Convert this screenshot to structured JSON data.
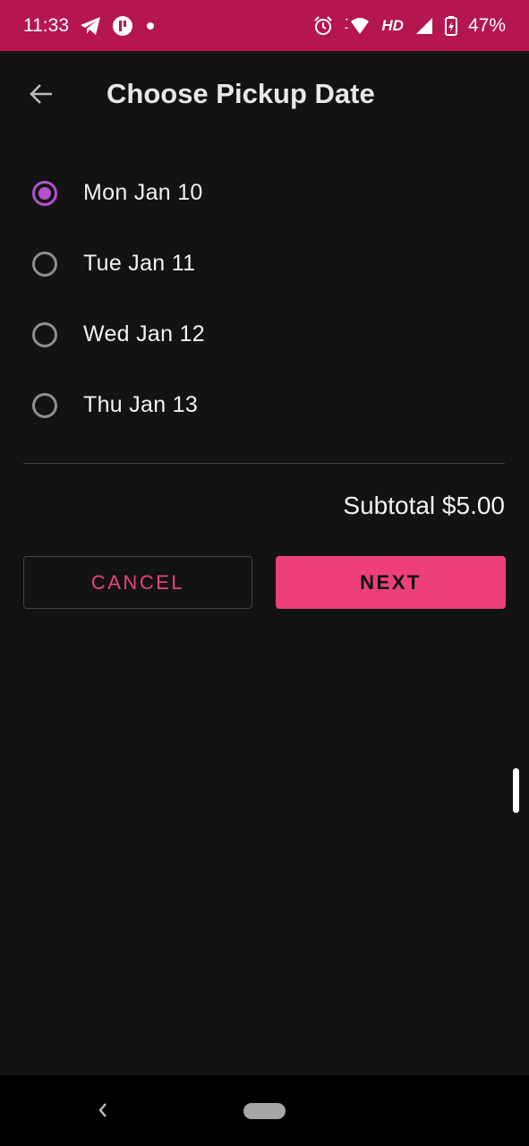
{
  "status_bar": {
    "time": "11:33",
    "left_icons": [
      "telegram-icon",
      "app-notification-icon",
      "notification-dot-icon"
    ],
    "right_icons": [
      "alarm-icon",
      "data-arrows-icon",
      "wifi-icon",
      "signal-icon",
      "battery-icon"
    ],
    "hd_label": "HD",
    "battery": "47%",
    "color": "#b5164f"
  },
  "app_bar": {
    "back_icon": "arrow-back-icon",
    "title": "Choose Pickup Date"
  },
  "date_options": [
    {
      "label": "Mon Jan 10",
      "selected": true
    },
    {
      "label": "Tue Jan 11",
      "selected": false
    },
    {
      "label": "Wed Jan 12",
      "selected": false
    },
    {
      "label": "Thu Jan 13",
      "selected": false
    }
  ],
  "subtotal": "Subtotal $5.00",
  "actions": {
    "cancel_label": "CANCEL",
    "next_label": "NEXT"
  },
  "colors": {
    "accent": "#ed3f7c",
    "radio_selected": "#b651cf",
    "background": "#131313"
  },
  "nav_bar": {
    "back_icon": "chevron-left-icon",
    "home_icon": "home-pill-icon"
  }
}
